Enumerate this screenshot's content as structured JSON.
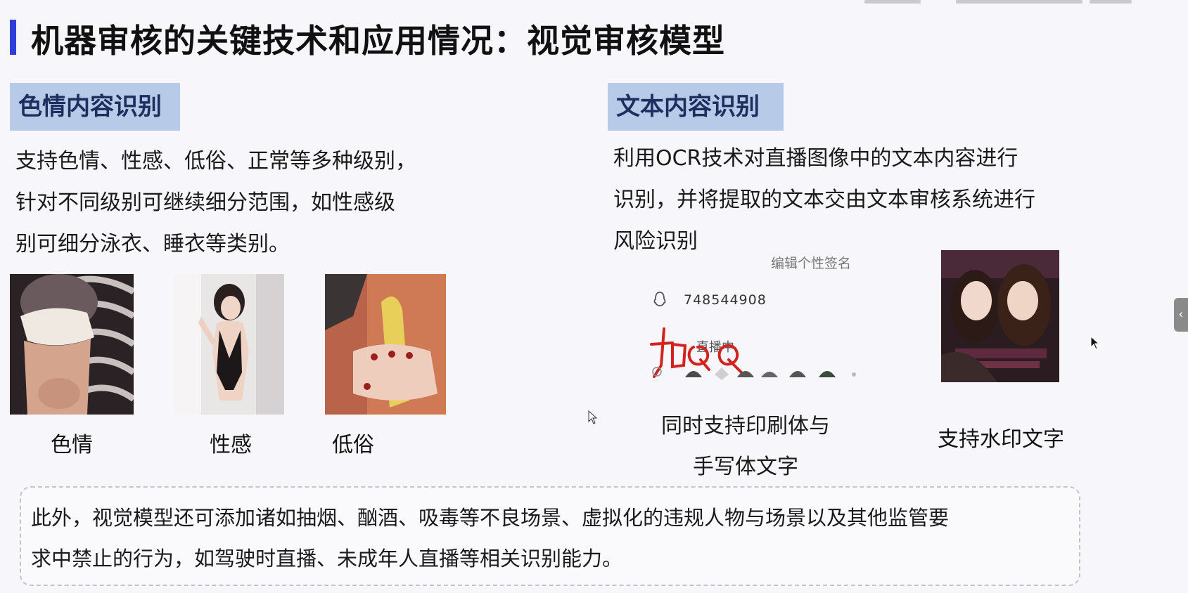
{
  "slide": {
    "title": "机器审核的关键技术和应用情况：视觉审核模型"
  },
  "porn_section": {
    "tag": "色情内容识别",
    "lines": [
      "支持色情、性感、低俗、正常等多种级别，",
      "针对不同级别可继续细分范围，如性感级",
      "别可细分泳衣、睡衣等类别。"
    ],
    "examples": [
      {
        "label": "色情",
        "icon": "photo-porn-example"
      },
      {
        "label": "性感",
        "icon": "photo-sexy-example"
      },
      {
        "label": "低俗",
        "icon": "photo-vulgar-example"
      }
    ]
  },
  "text_section": {
    "tag": "文本内容识别",
    "lines": [
      "利用OCR技术对直播图像中的文本内容进行",
      "识别，并将提取的文本交由文本审核系统进行",
      "风险识别"
    ],
    "ocr_example": {
      "header": "编辑个性签名",
      "qq_number": "748544908",
      "status": "直播中",
      "handwriting": "加QQ",
      "caption_lines": [
        "同时支持印刷体与",
        "手写体文字"
      ]
    },
    "watermark_example": {
      "caption": "支持水印文字"
    }
  },
  "note": {
    "lines": [
      "此外，视觉模型还可添加诸如抽烟、酗酒、吸毒等不良场景、虚拟化的违规人物与场景以及其他监管要",
      "求中禁止的行为，如驾驶时直播、未成年人直播等相关识别能力。"
    ]
  },
  "ui": {
    "side_handle_icon": "chevron-left-icon",
    "side_handle_glyph": "‹"
  },
  "colors": {
    "title_accent": "#2f3ed8",
    "tag_background": "#b7cbe8",
    "handwriting": "#d2231e"
  }
}
